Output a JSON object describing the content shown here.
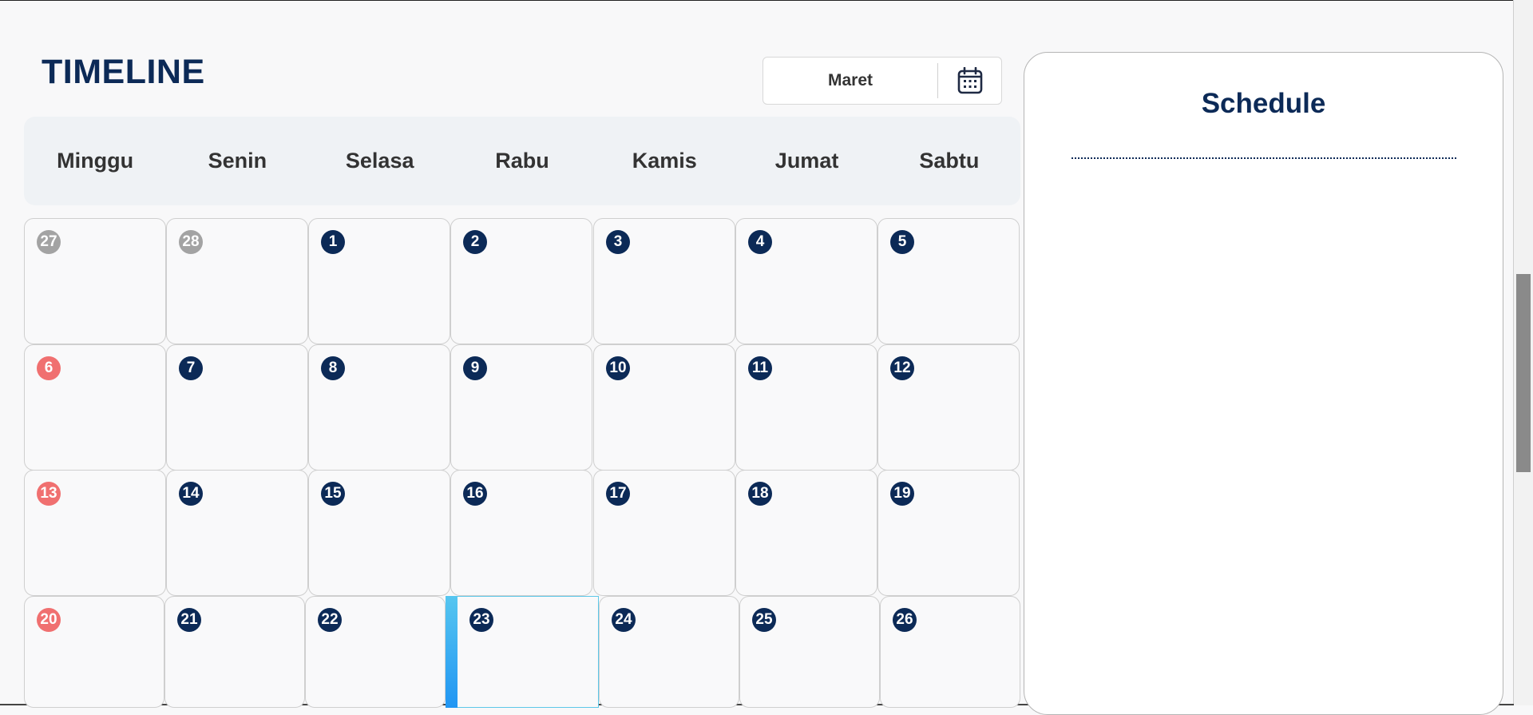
{
  "timeline": {
    "title": "TIMELINE",
    "month": "Maret",
    "calendar_icon": "calendar-icon"
  },
  "weekdays": [
    "Minggu",
    "Senin",
    "Selasa",
    "Rabu",
    "Kamis",
    "Jumat",
    "Sabtu"
  ],
  "weeks": [
    [
      {
        "day": "27",
        "kind": "muted"
      },
      {
        "day": "28",
        "kind": "muted"
      },
      {
        "day": "1",
        "kind": "normal"
      },
      {
        "day": "2",
        "kind": "normal"
      },
      {
        "day": "3",
        "kind": "normal"
      },
      {
        "day": "4",
        "kind": "normal"
      },
      {
        "day": "5",
        "kind": "normal"
      }
    ],
    [
      {
        "day": "6",
        "kind": "sunday"
      },
      {
        "day": "7",
        "kind": "normal"
      },
      {
        "day": "8",
        "kind": "normal"
      },
      {
        "day": "9",
        "kind": "normal"
      },
      {
        "day": "10",
        "kind": "normal"
      },
      {
        "day": "11",
        "kind": "normal"
      },
      {
        "day": "12",
        "kind": "normal"
      }
    ],
    [
      {
        "day": "13",
        "kind": "sunday"
      },
      {
        "day": "14",
        "kind": "normal"
      },
      {
        "day": "15",
        "kind": "normal"
      },
      {
        "day": "16",
        "kind": "normal"
      },
      {
        "day": "17",
        "kind": "normal"
      },
      {
        "day": "18",
        "kind": "normal"
      },
      {
        "day": "19",
        "kind": "normal"
      }
    ],
    [
      {
        "day": "20",
        "kind": "sunday"
      },
      {
        "day": "21",
        "kind": "normal"
      },
      {
        "day": "22",
        "kind": "normal"
      },
      {
        "day": "23",
        "kind": "today"
      },
      {
        "day": "24",
        "kind": "normal"
      },
      {
        "day": "25",
        "kind": "normal"
      },
      {
        "day": "26",
        "kind": "normal"
      }
    ]
  ],
  "schedule": {
    "title": "Schedule"
  },
  "colors": {
    "primary": "#0c2a57",
    "sunday": "#f07070",
    "muted": "#a3a3a3",
    "today_accent": "#2196f3"
  }
}
